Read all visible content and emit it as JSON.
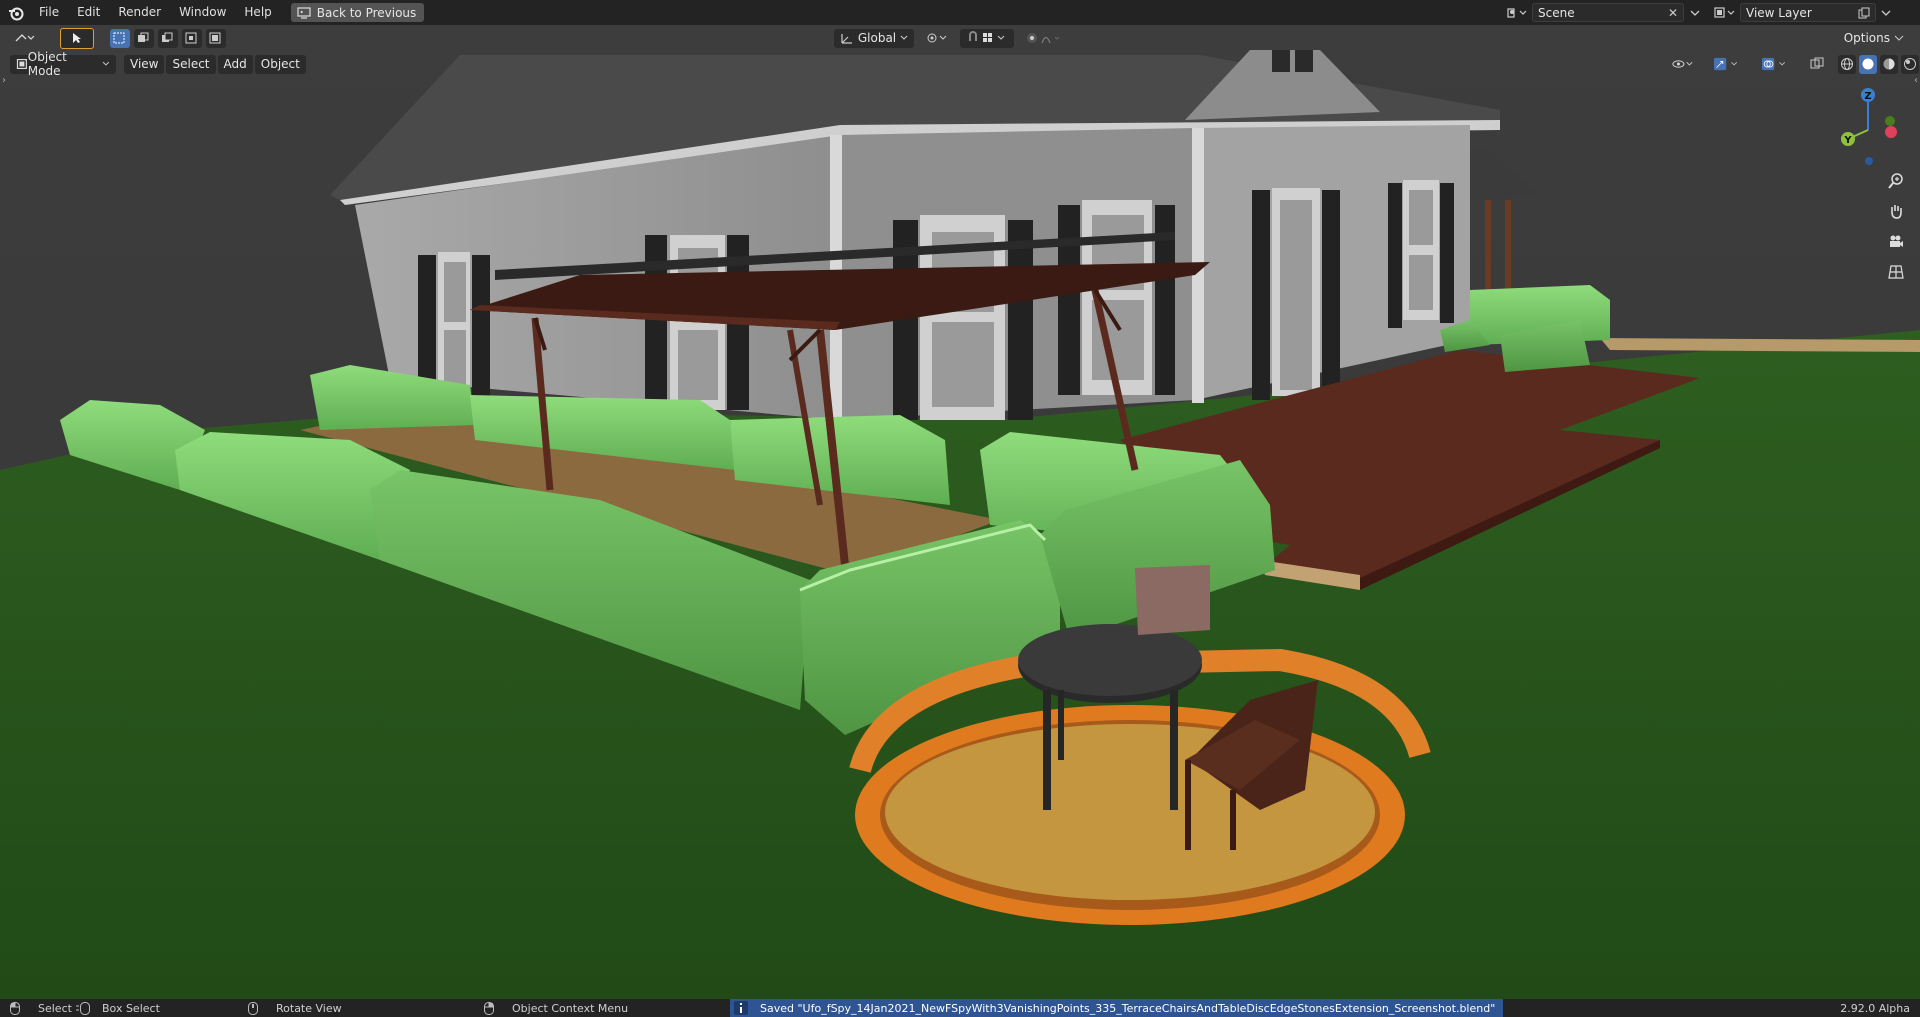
{
  "topbar": {
    "menus": [
      "File",
      "Edit",
      "Render",
      "Window",
      "Help"
    ],
    "back_button": "Back to Previous",
    "scene": "Scene",
    "view_layer": "View Layer"
  },
  "tool_header": {
    "orientation": "Global",
    "options": "Options"
  },
  "viewport_header": {
    "mode": "Object Mode",
    "menus": [
      "View",
      "Select",
      "Add",
      "Object"
    ]
  },
  "gizmo": {
    "z": "Z",
    "y": "Y"
  },
  "statusbar": {
    "select": "Select",
    "box_select": "Box Select",
    "rotate": "Rotate View",
    "context_menu": "Object Context Menu",
    "saved": "Saved \"Ufo_fSpy_14Jan2021_NewFSpyWith3VanishingPoints_335_TerraceChairsAndTableDiscEdgeStonesExtension_Screenshot.blend\"",
    "version": "2.92.0 Alpha"
  },
  "colors": {
    "accent": "#4772b3",
    "grass": "#2c5a1e",
    "hedge": "#7fcf6e",
    "deck": "#5a2a1e",
    "bricks": "#e07a1e"
  }
}
